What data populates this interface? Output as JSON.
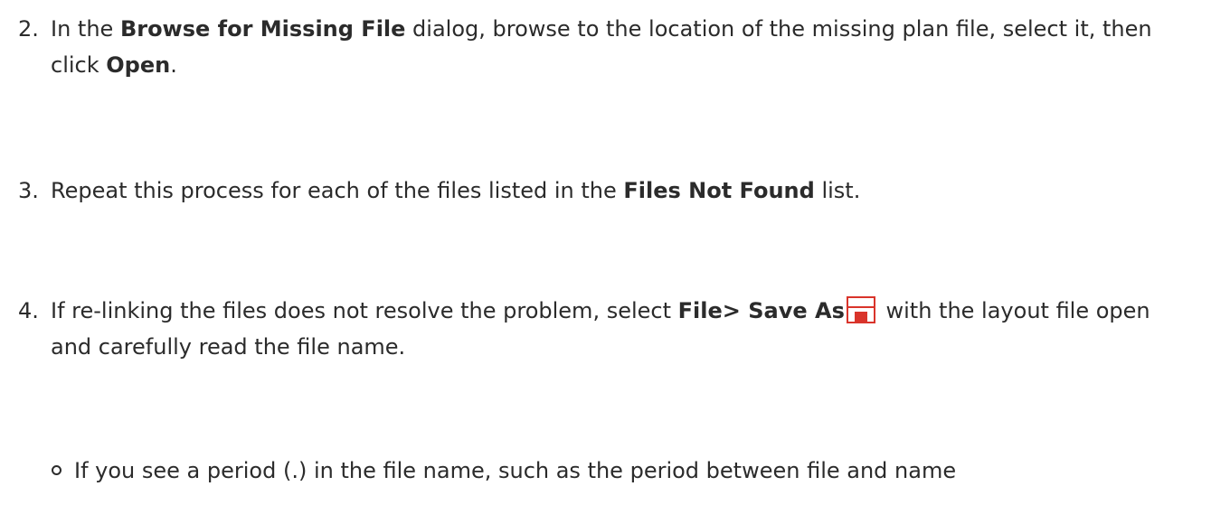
{
  "steps": [
    {
      "number": "2.",
      "t1": "In the ",
      "b1": "Browse for Missing File",
      "t2": " dialog, browse to the location of the missing plan file, select it, then click ",
      "b2": "Open",
      "t3": "."
    },
    {
      "number": "3.",
      "t1": "Repeat this process for each of the files listed in the ",
      "b1": "Files Not Found",
      "t2": " list."
    },
    {
      "number": "4.",
      "t1": "If re-linking the files does not resolve the problem, select ",
      "b1": "File> Save As",
      "icon": "save-as-icon",
      "t2": " with the layout file open and carefully read the file name."
    }
  ],
  "sub_bullet": {
    "text": "If you see a period (.) in the file name, such as the period between file and name"
  },
  "colors": {
    "text": "#2b2b2b",
    "icon_red": "#d9342b"
  }
}
